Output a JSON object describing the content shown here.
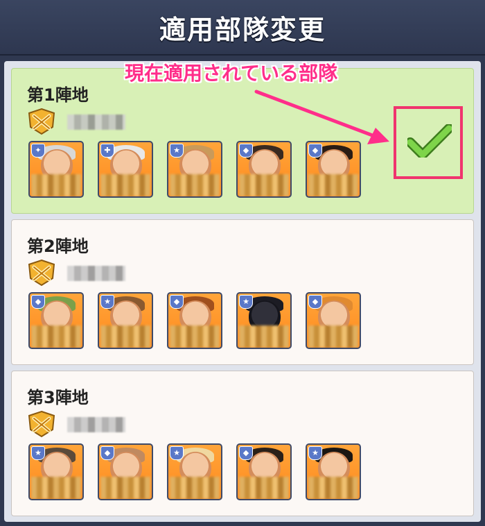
{
  "header": {
    "title": "適用部隊変更"
  },
  "annotation": {
    "label": "現在適用されている部隊",
    "color": "#ff2e8a"
  },
  "squads": [
    {
      "title": "第1陣地",
      "active": true
    },
    {
      "title": "第2陣地",
      "active": false
    },
    {
      "title": "第3陣地",
      "active": false
    }
  ],
  "icons": {
    "emblem": "crossed-swords-badge-icon",
    "check": "checkmark-icon"
  },
  "colors": {
    "active_card": "#d8f0b6",
    "inactive_card": "#fcf8f5",
    "hero_bg": "#ff9a2c",
    "highlight": "#f0346e"
  }
}
